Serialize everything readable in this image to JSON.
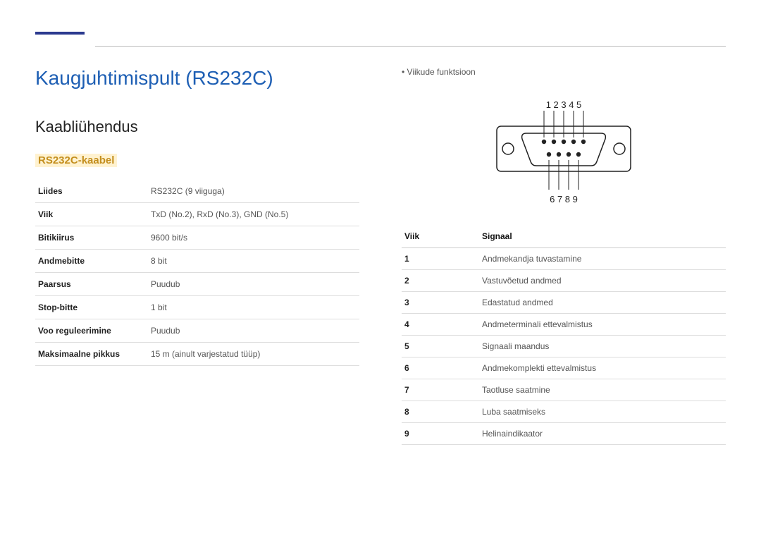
{
  "title": "Kaugjuhtimispult (RS232C)",
  "section": "Kaabliühendus",
  "subsection": "RS232C-kaabel",
  "spec_rows": [
    {
      "label": "Liides",
      "value": "RS232C (9 viiguga)"
    },
    {
      "label": "Viik",
      "value": "TxD (No.2), RxD (No.3), GND (No.5)"
    },
    {
      "label": "Bitikiirus",
      "value": "9600 bit/s"
    },
    {
      "label": "Andmebitte",
      "value": "8 bit"
    },
    {
      "label": "Paarsus",
      "value": "Puudub"
    },
    {
      "label": "Stop-bitte",
      "value": "1 bit"
    },
    {
      "label": "Voo reguleerimine",
      "value": "Puudub"
    },
    {
      "label": "Maksimaalne pikkus",
      "value": "15 m (ainult varjestatud tüüp)"
    }
  ],
  "right_bullet": "Viikude funktsioon",
  "top_numbers": "1 2 3 4 5",
  "bottom_numbers": "6 7 8 9",
  "pin_header": {
    "pin": "Viik",
    "signal": "Signaal"
  },
  "pin_rows": [
    {
      "pin": "1",
      "signal": "Andmekandja tuvastamine"
    },
    {
      "pin": "2",
      "signal": "Vastuvõetud andmed"
    },
    {
      "pin": "3",
      "signal": "Edastatud andmed"
    },
    {
      "pin": "4",
      "signal": "Andmeterminali ettevalmistus"
    },
    {
      "pin": "5",
      "signal": "Signaali maandus"
    },
    {
      "pin": "6",
      "signal": "Andmekomplekti ettevalmistus"
    },
    {
      "pin": "7",
      "signal": "Taotluse saatmine"
    },
    {
      "pin": "8",
      "signal": "Luba saatmiseks"
    },
    {
      "pin": "9",
      "signal": "Helinaindikaator"
    }
  ]
}
